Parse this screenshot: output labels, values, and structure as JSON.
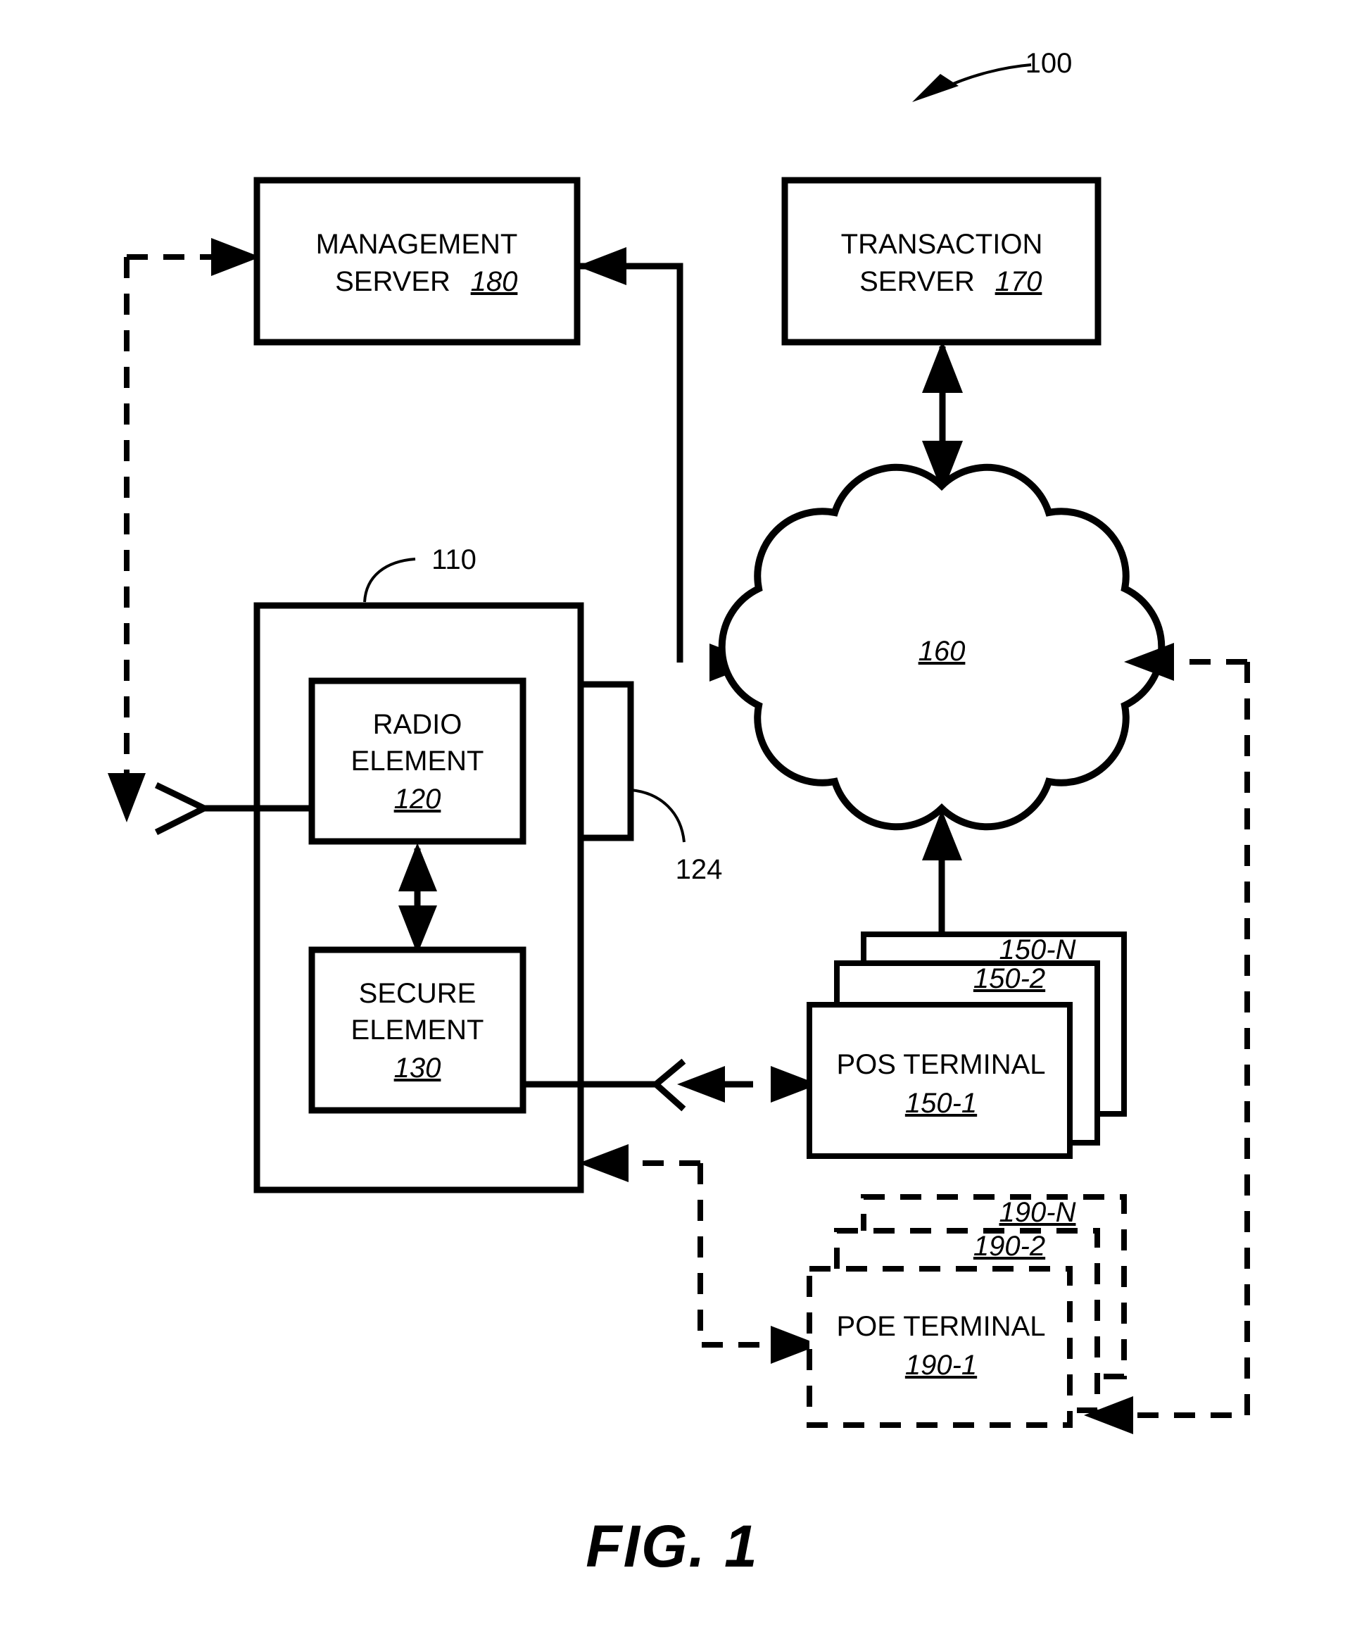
{
  "figure": {
    "caption": "FIG. 1",
    "system_ref": "100"
  },
  "nodes": {
    "management_server": {
      "line1": "MANAGEMENT",
      "line2": "SERVER",
      "ref": "180"
    },
    "transaction_server": {
      "line1": "TRANSACTION",
      "line2": "SERVER",
      "ref": "170"
    },
    "network_cloud": {
      "ref": "160"
    },
    "mobile_device": {
      "ref": "110",
      "antenna_port_ref": "124"
    },
    "radio_element": {
      "line1": "RADIO",
      "line2": "ELEMENT",
      "ref": "120"
    },
    "secure_element": {
      "line1": "SECURE",
      "line2": "ELEMENT",
      "ref": "130"
    },
    "pos_terminal": {
      "label": "POS TERMINAL",
      "ref_front": "150-1",
      "ref_middle": "150-2",
      "ref_back": "150-N"
    },
    "poe_terminal": {
      "label": "POE TERMINAL",
      "ref_front": "190-1",
      "ref_middle": "190-2",
      "ref_back": "190-N"
    }
  },
  "colors": {
    "ink": "#000000",
    "paper": "#ffffff"
  }
}
